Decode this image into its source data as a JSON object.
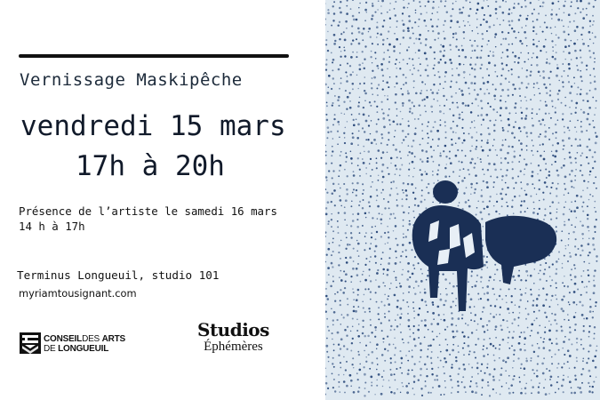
{
  "event": {
    "title": "Vernissage Maskipêche",
    "date": "vendredi 15 mars",
    "hours": "17h à 20h",
    "presence_line1": "Présence de l’artiste le samedi 16 mars",
    "presence_line2": "14 h à 17h",
    "venue": "Terminus Longueuil, studio 101",
    "website": "myriamtousignant.com"
  },
  "logos": {
    "conseil_line1_bold": "CONSEIL",
    "conseil_line1_light": "DES ",
    "conseil_line1_bold2": "ARTS",
    "conseil_line2_light": "DE ",
    "conseil_line2_bold": "LONGUEUIL",
    "studios": "Studios",
    "ephemeres": "Éphémères"
  },
  "colors": {
    "text": "#1c2a3a",
    "rule": "#111111",
    "artwork_background": "#dfe9f1",
    "artwork_dots": "#1f3f73"
  }
}
